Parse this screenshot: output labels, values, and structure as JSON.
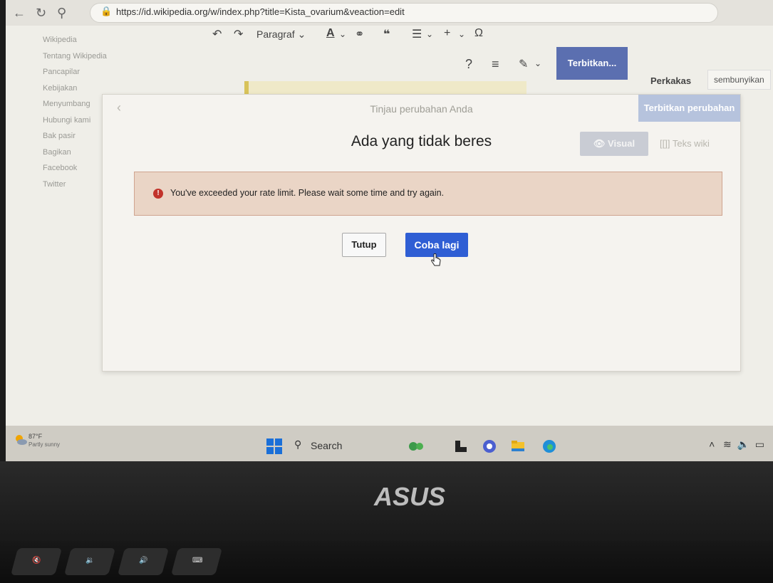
{
  "browser": {
    "url": "https://id.wikipedia.org/w/index.php?title=Kista_ovarium&veaction=edit"
  },
  "sidebar": {
    "items": [
      "Wikipedia",
      "Tentang Wikipedia",
      "Pancapilar",
      "Kebijakan",
      "Menyumbang",
      "Hubungi kami",
      "Bak pasir",
      "Bagikan",
      "Facebook",
      "Twitter"
    ]
  },
  "toolbar": {
    "paragraph": "Paragraf",
    "help": "?",
    "publish": "Terbitkan...",
    "tools": "Perkakas",
    "hide": "sembunyikan"
  },
  "dialog": {
    "title": "Tinjau perubahan Anda",
    "publish_changes": "Terbitkan perubahan",
    "heading": "Ada yang tidak beres",
    "visual": "Visual",
    "wikitext": "Teks wiki",
    "error_message": "You've exceeded your rate limit. Please wait some time and try again.",
    "close_button": "Tutup",
    "retry_button": "Coba lagi"
  },
  "taskbar": {
    "weather_temp": "87°F",
    "weather_desc": "Partly sunny",
    "search_label": "Search"
  },
  "laptop": {
    "brand": "ASUS"
  },
  "colors": {
    "primary_button": "#2f5ed4",
    "error_background": "#ead5c6",
    "error_icon": "#c2332b",
    "publish_button": "#5b6fb0"
  }
}
